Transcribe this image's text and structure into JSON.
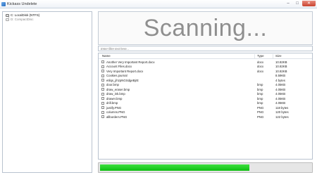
{
  "window": {
    "title": "Kickass Undelete",
    "min": "–",
    "max": "□",
    "close": "✕"
  },
  "tree": {
    "items": [
      {
        "label": "C: LocalDisk (NTFS)"
      },
      {
        "label": "D: CompactDisc"
      }
    ]
  },
  "status": {
    "text": "Scanning..."
  },
  "filter": {
    "placeholder": "Enter filter text here..."
  },
  "table": {
    "columns": {
      "name": "Name",
      "type": "Type",
      "size": "Size"
    },
    "rows": [
      {
        "name": "Another Very Important Report.docx",
        "type": "docx",
        "size": "10.82KB"
      },
      {
        "name": "Account Files.docx",
        "type": "docx",
        "size": "10.82KB"
      },
      {
        "name": "Very Important Report.docx",
        "type": "docx",
        "size": "10.82KB"
      },
      {
        "name": "Cookies.journal",
        "type": "",
        "size": "8.59KB"
      },
      {
        "name": "etilqs_jihzpNGSdgeBjrE",
        "type": "",
        "size": "4 bytes"
      },
      {
        "name": "door.bmp",
        "type": "bmp",
        "size": "4.05KB"
      },
      {
        "name": "draw_eraser.bmp",
        "type": "bmp",
        "size": "4.05KB"
      },
      {
        "name": "draw_ink.bmp",
        "type": "bmp",
        "size": "4.05KB"
      },
      {
        "name": "drawer.bmp",
        "type": "bmp",
        "size": "4.05KB"
      },
      {
        "name": "drill.bmp",
        "type": "bmp",
        "size": "4.05KB"
      },
      {
        "name": "justify.PNG",
        "type": "PNG",
        "size": "118 bytes"
      },
      {
        "name": "columns.PNG",
        "type": "PNG",
        "size": "120 bytes"
      },
      {
        "name": "allborders.PNG",
        "type": "PNG",
        "size": "122 bytes"
      }
    ]
  },
  "progress": {
    "percent": 71,
    "fill_color": "#12c414"
  },
  "icons": {
    "app": "app-icon",
    "drive": "drive-icon"
  }
}
